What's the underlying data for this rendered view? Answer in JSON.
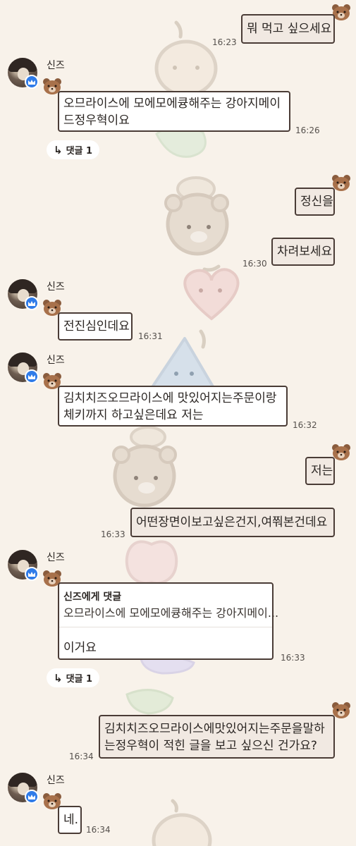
{
  "colors": {
    "background": "#f8f2ea",
    "bubble_border": "#4a3c36",
    "bubble_in": "#ffffff",
    "bubble_out": "#f1e9e2",
    "verified_badge": "#2f7be8"
  },
  "messages": [
    {
      "side": "out",
      "lines": [
        "뭐 먹고 싶으세요"
      ],
      "time": "16:23"
    },
    {
      "side": "in",
      "sender": "신즈",
      "lines": [
        "오므라이스에 모에모에큥해주는 강아지메이",
        "드정우혁이요"
      ],
      "time": "16:26",
      "reply_count": "댓글 1"
    },
    {
      "side": "out",
      "lines": [
        "정신을"
      ]
    },
    {
      "side": "out",
      "lines": [
        "차려보세요"
      ],
      "time": "16:30"
    },
    {
      "side": "in",
      "sender": "신즈",
      "lines": [
        "전진심인데요"
      ],
      "time": "16:31"
    },
    {
      "side": "in",
      "sender": "신즈",
      "lines": [
        "김치치즈오므라이스에 맛있어지는주문이랑",
        "체키까지 하고싶은데요 저는"
      ],
      "time": "16:32"
    },
    {
      "side": "out",
      "lines": [
        "저는"
      ]
    },
    {
      "side": "out",
      "lines": [
        "어떤장면이보고싶은건지,여쭤본건데요"
      ],
      "time": "16:33"
    },
    {
      "side": "in",
      "sender": "신즈",
      "quote_title": "신즈에게 댓글",
      "quote_text": "오므라이스에 모에모에큥해주는 강아지메이...",
      "lines": [
        "이거요"
      ],
      "time": "16:33",
      "reply_count": "댓글 1"
    },
    {
      "side": "out",
      "lines": [
        "김치치즈오므라이스에맛있어지는주문을말하",
        "는정우혁이 적힌 글을 보고 싶으신 건가요?"
      ],
      "time": "16:34"
    },
    {
      "side": "in",
      "sender": "신즈",
      "lines": [
        "네."
      ],
      "time": "16:34"
    }
  ]
}
